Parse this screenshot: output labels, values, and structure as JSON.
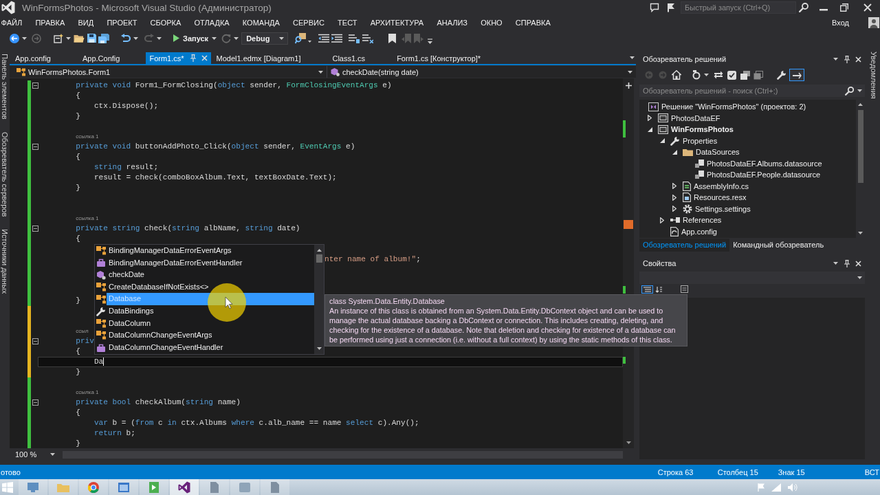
{
  "window": {
    "title": "WinFormsPhotos - Microsoft Visual Studio (Администратор)",
    "quick_launch": {
      "placeholder": "Быстрый запуск (Ctrl+Q)"
    },
    "account": "Вход"
  },
  "menu": [
    "ФАЙЛ",
    "ПРАВКА",
    "ВИД",
    "ПРОЕКТ",
    "СБОРКА",
    "ОТЛАДКА",
    "КОМАНДА",
    "СЕРВИС",
    "ТЕСТ",
    "АРХИТЕКТУРА",
    "АНАЛИЗ",
    "ОКНО",
    "СПРАВКА"
  ],
  "toolbar": {
    "start": "Запуск",
    "configuration": "Debug"
  },
  "left_rail": [
    "Панель элементов",
    "Обозреватель серверов",
    "Источники данных"
  ],
  "tabs": [
    {
      "label": "App.config",
      "selected": false
    },
    {
      "label": "App.Config",
      "selected": false
    },
    {
      "label": "Form1.cs*",
      "selected": true
    },
    {
      "label": "Model1.edmx [Diagram1]",
      "selected": false
    },
    {
      "label": "Class1.cs",
      "selected": false
    },
    {
      "label": "Form1.cs [Конструктор]*",
      "selected": false
    }
  ],
  "navigation": {
    "type": "WinFormsPhotos.Form1",
    "member": "checkDate(string date)"
  },
  "editor": {
    "lines": [
      {
        "kind": "member",
        "unsaved": false,
        "fold": true,
        "current": false,
        "tokens": [
          {
            "kind": "keyword",
            "text": "private void"
          },
          {
            "kind": "plain",
            "text": " Form1_FormClosing("
          },
          {
            "kind": "keyword",
            "text": "object"
          },
          {
            "kind": "plain",
            "text": " sender, "
          },
          {
            "kind": "type",
            "text": "FormClosingEventArgs"
          },
          {
            "kind": "plain",
            "text": " e)"
          }
        ]
      },
      {
        "kind": "member",
        "unsaved": false,
        "fold": false,
        "current": false,
        "tokens": [
          {
            "kind": "plain",
            "text": "{"
          }
        ]
      },
      {
        "kind": "body",
        "unsaved": false,
        "fold": false,
        "current": false,
        "tokens": [
          {
            "kind": "plain",
            "text": "ctx.Dispose();"
          }
        ]
      },
      {
        "kind": "member",
        "unsaved": false,
        "fold": false,
        "current": false,
        "tokens": [
          {
            "kind": "plain",
            "text": "}"
          }
        ]
      },
      {
        "kind": "blank",
        "unsaved": false
      },
      {
        "kind": "codelens",
        "unsaved": false,
        "text": "ссылка 1"
      },
      {
        "kind": "member",
        "unsaved": false,
        "fold": true,
        "current": false,
        "tokens": [
          {
            "kind": "keyword",
            "text": "private void"
          },
          {
            "kind": "plain",
            "text": " buttonAddPhoto_Click("
          },
          {
            "kind": "keyword",
            "text": "object"
          },
          {
            "kind": "plain",
            "text": " sender, "
          },
          {
            "kind": "type",
            "text": "EventArgs"
          },
          {
            "kind": "plain",
            "text": " e)"
          }
        ]
      },
      {
        "kind": "member",
        "unsaved": false,
        "fold": false,
        "current": false,
        "tokens": [
          {
            "kind": "plain",
            "text": "{"
          }
        ]
      },
      {
        "kind": "body",
        "unsaved": false,
        "fold": false,
        "current": false,
        "tokens": [
          {
            "kind": "keyword",
            "text": "string"
          },
          {
            "kind": "plain",
            "text": " result;"
          }
        ]
      },
      {
        "kind": "body",
        "unsaved": false,
        "fold": false,
        "current": false,
        "tokens": [
          {
            "kind": "plain",
            "text": "result = check(comboBoxAlbum.Text, textBoxDate.Text);"
          }
        ]
      },
      {
        "kind": "member",
        "unsaved": false,
        "fold": false,
        "current": false,
        "tokens": [
          {
            "kind": "plain",
            "text": "}"
          }
        ]
      },
      {
        "kind": "blank",
        "unsaved": false
      },
      {
        "kind": "blank",
        "unsaved": false
      },
      {
        "kind": "codelens",
        "unsaved": false,
        "text": "ссылка 1"
      },
      {
        "kind": "member",
        "unsaved": false,
        "fold": true,
        "current": false,
        "tokens": [
          {
            "kind": "keyword",
            "text": "private string"
          },
          {
            "kind": "plain",
            "text": " check("
          },
          {
            "kind": "keyword",
            "text": "string"
          },
          {
            "kind": "plain",
            "text": " albName, "
          },
          {
            "kind": "keyword",
            "text": "string"
          },
          {
            "kind": "plain",
            "text": " date)"
          }
        ]
      },
      {
        "kind": "member",
        "unsaved": false,
        "fold": false,
        "current": false,
        "tokens": [
          {
            "kind": "plain",
            "text": "{"
          }
        ]
      },
      {
        "kind": "blank",
        "unsaved": false
      },
      {
        "kind": "partial",
        "unsaved": false,
        "fold": false,
        "current": false,
        "tokens": [
          {
            "kind": "string",
            "text": "nter name of album!\""
          },
          {
            "kind": "plain",
            "text": ";"
          }
        ]
      },
      {
        "kind": "blank",
        "unsaved": false
      },
      {
        "kind": "blank",
        "unsaved": false
      },
      {
        "kind": "blank",
        "unsaved": false
      },
      {
        "kind": "member",
        "unsaved": false,
        "fold": false,
        "current": false,
        "tokens": [
          {
            "kind": "plain",
            "text": "}"
          }
        ]
      },
      {
        "kind": "blank",
        "unsaved": true
      },
      {
        "kind": "blank",
        "unsaved": true
      },
      {
        "kind": "codelens",
        "unsaved": true,
        "text": "ссыл"
      },
      {
        "kind": "member",
        "unsaved": true,
        "fold": true,
        "current": false,
        "tokens": [
          {
            "kind": "keyword",
            "text": "priv"
          }
        ]
      },
      {
        "kind": "member",
        "unsaved": true,
        "fold": false,
        "current": false,
        "tokens": [
          {
            "kind": "plain",
            "text": "{"
          }
        ]
      },
      {
        "kind": "body",
        "unsaved": true,
        "fold": false,
        "current": true,
        "tokens": [
          {
            "kind": "plain",
            "text": "Da"
          }
        ]
      },
      {
        "kind": "member",
        "unsaved": true,
        "fold": false,
        "current": false,
        "tokens": [
          {
            "kind": "plain",
            "text": "}"
          }
        ]
      },
      {
        "kind": "blank",
        "unsaved": false
      },
      {
        "kind": "codelens",
        "unsaved": false,
        "text": "ссылка 1"
      },
      {
        "kind": "member",
        "unsaved": false,
        "fold": true,
        "current": false,
        "tokens": [
          {
            "kind": "keyword",
            "text": "private bool"
          },
          {
            "kind": "plain",
            "text": " checkAlbum("
          },
          {
            "kind": "keyword",
            "text": "string"
          },
          {
            "kind": "plain",
            "text": " name)"
          }
        ]
      },
      {
        "kind": "member",
        "unsaved": false,
        "fold": false,
        "current": false,
        "tokens": [
          {
            "kind": "plain",
            "text": "{"
          }
        ]
      },
      {
        "kind": "body",
        "unsaved": false,
        "fold": false,
        "current": false,
        "tokens": [
          {
            "kind": "keyword",
            "text": "var"
          },
          {
            "kind": "plain",
            "text": " b = ("
          },
          {
            "kind": "keyword",
            "text": "from"
          },
          {
            "kind": "plain",
            "text": " c "
          },
          {
            "kind": "keyword",
            "text": "in"
          },
          {
            "kind": "plain",
            "text": " ctx.Albums "
          },
          {
            "kind": "keyword",
            "text": "where"
          },
          {
            "kind": "plain",
            "text": " c.alb_name == name "
          },
          {
            "kind": "keyword",
            "text": "select"
          },
          {
            "kind": "plain",
            "text": " c).Any();"
          }
        ]
      },
      {
        "kind": "body",
        "unsaved": false,
        "fold": false,
        "current": false,
        "tokens": [
          {
            "kind": "keyword",
            "text": "return"
          },
          {
            "kind": "plain",
            "text": " b;"
          }
        ]
      },
      {
        "kind": "member",
        "unsaved": false,
        "fold": false,
        "current": false,
        "tokens": [
          {
            "kind": "plain",
            "text": "}"
          }
        ]
      }
    ],
    "zoom": "100 %"
  },
  "completion": {
    "items": [
      {
        "label": "BindingManagerDataErrorEventArgs",
        "kind": "class",
        "selected": false
      },
      {
        "label": "BindingManagerDataErrorEventHandler",
        "kind": "delegate",
        "selected": false
      },
      {
        "label": "checkDate",
        "kind": "method",
        "selected": false
      },
      {
        "label": "CreateDatabaseIfNotExists<>",
        "kind": "class",
        "selected": false
      },
      {
        "label": "Database",
        "kind": "class",
        "selected": true
      },
      {
        "label": "DataBindings",
        "kind": "property",
        "selected": false
      },
      {
        "label": "DataColumn",
        "kind": "class",
        "selected": false
      },
      {
        "label": "DataColumnChangeEventArgs",
        "kind": "class",
        "selected": false
      },
      {
        "label": "DataColumnChangeEventHandler",
        "kind": "delegate",
        "selected": false
      }
    ]
  },
  "tooltip": {
    "signature": "class System.Data.Entity.Database",
    "description": "An instance of this class is obtained from an System.Data.Entity.DbContext object and can be used to manage the actual database backing a DbContext or connection. This includes creating, deleting, and checking for the existence of a database. Note that deletion and checking for existence of a database can be performed using just a connection (i.e. without a full context) by using the static methods of this class."
  },
  "solution_explorer": {
    "title": "Обозреватель решений",
    "preview": true,
    "search": {
      "placeholder": "Обозреватель решений - поиск (Ctrl+;)"
    },
    "solution": "Решение \"WinFormsPhotos\" (проектов: 2)",
    "tree": [
      {
        "label": "PhotosDataEF",
        "kind": "project",
        "expanded": false,
        "startup": false
      },
      {
        "label": "WinFormsPhotos",
        "kind": "project",
        "expanded": true,
        "startup": true,
        "children": [
          {
            "label": "Properties",
            "kind": "properties",
            "expanded": true,
            "children": [
              {
                "label": "DataSources",
                "kind": "folder",
                "expanded": true,
                "children": [
                  {
                    "label": "PhotosDataEF.Albums.datasource",
                    "kind": "datasource"
                  },
                  {
                    "label": "PhotosDataEF.People.datasource",
                    "kind": "datasource"
                  }
                ]
              },
              {
                "label": "AssemblyInfo.cs",
                "kind": "csharp",
                "expanded": false
              },
              {
                "label": "Resources.resx",
                "kind": "resx",
                "expanded": false
              },
              {
                "label": "Settings.settings",
                "kind": "settings",
                "expanded": false
              }
            ]
          },
          {
            "label": "References",
            "kind": "references",
            "expanded": false
          },
          {
            "label": "App.config",
            "kind": "config"
          }
        ]
      }
    ],
    "tabs": [
      {
        "label": "Обозреватель решений",
        "selected": true
      },
      {
        "label": "Командный обозреватель",
        "selected": false
      }
    ]
  },
  "properties": {
    "title": "Свойства",
    "categorized": true
  },
  "right_rail": [
    "Уведомления"
  ],
  "status_bar": {
    "message": "отово",
    "line": "Строка 63",
    "column": "Столбец 15",
    "char": "Знак 15",
    "mode": "ВСТ"
  },
  "taskbar": {
    "apps": [
      {
        "kind": "desktop",
        "selected": false
      },
      {
        "kind": "explorer",
        "selected": false
      },
      {
        "kind": "browser",
        "selected": false
      },
      {
        "kind": "window",
        "selected": false
      },
      {
        "kind": "tile",
        "selected": false
      },
      {
        "kind": "ide",
        "selected": true
      },
      {
        "kind": "document",
        "selected": false
      },
      {
        "kind": "app",
        "selected": false
      },
      {
        "kind": "document",
        "selected": false
      }
    ]
  }
}
